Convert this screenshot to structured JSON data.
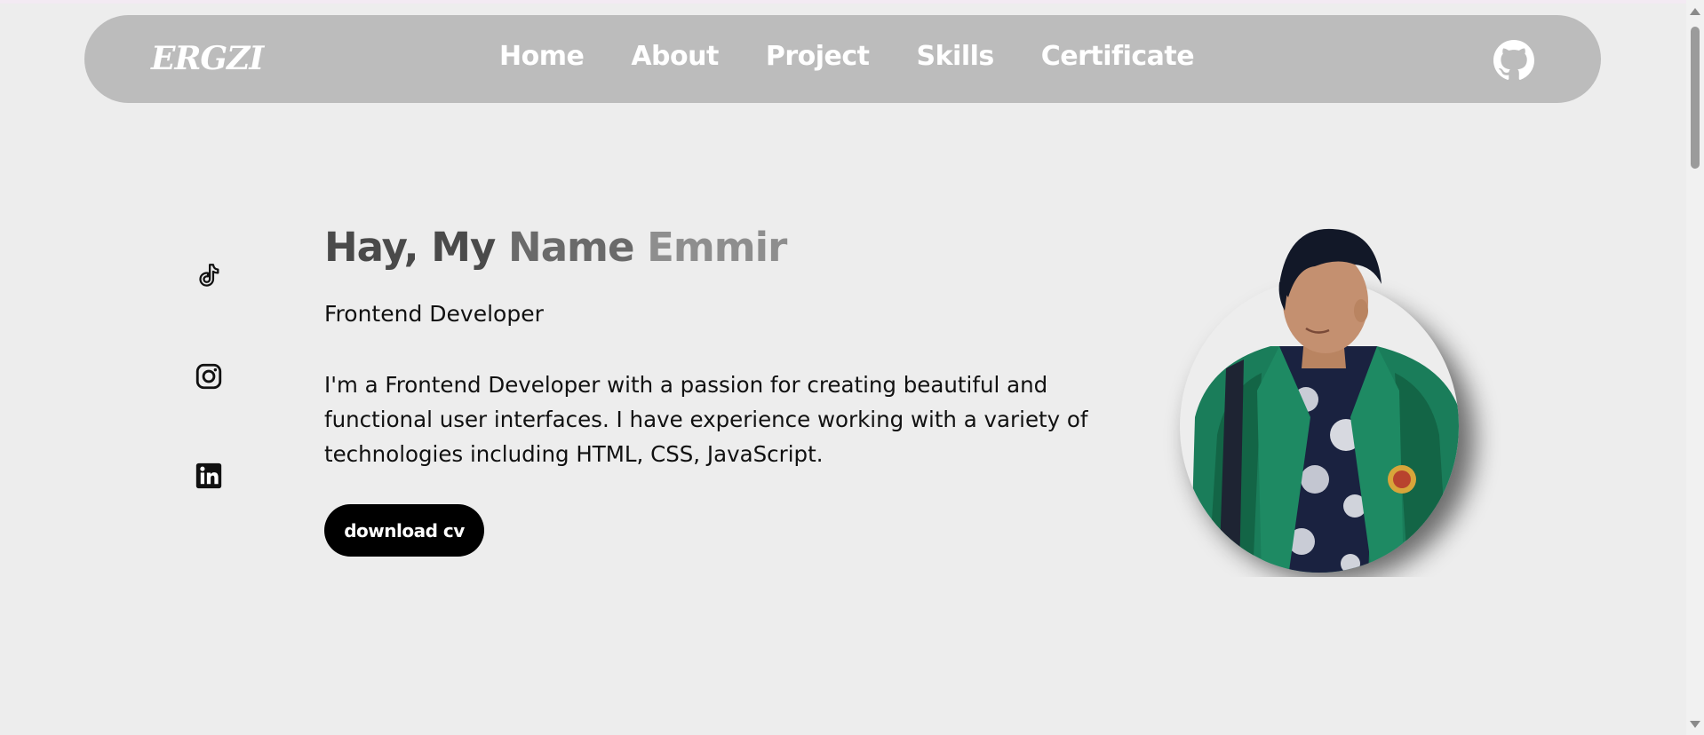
{
  "nav": {
    "logo": "ERGZI",
    "links": [
      "Home",
      "About",
      "Project",
      "Skills",
      "Certificate"
    ],
    "github_icon": "github-icon"
  },
  "social": {
    "icons": [
      "tiktok-icon",
      "instagram-icon",
      "linkedin-icon"
    ]
  },
  "hero": {
    "title_part1": "Hay, My",
    "title_part2": "Name",
    "title_part3": "Emmir",
    "role": "Frontend Developer",
    "description": "I'm a Frontend Developer with a passion for creating beautiful and functional user interfaces. I have experience working with a variety of technologies including HTML, CSS, JavaScript.",
    "cv_button": "download cv"
  },
  "colors": {
    "background": "#ededed",
    "navbar": "#bcbcbc",
    "button": "#000000",
    "jacket_green": "#1a7d5a"
  }
}
